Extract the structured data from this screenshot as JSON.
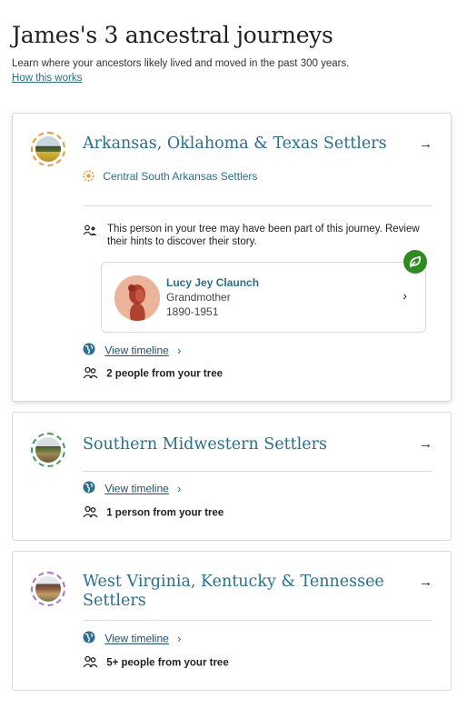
{
  "header": {
    "title": "James's 3 ancestral journeys",
    "subtitle": "Learn where your ancestors likely lived and moved in the past 300 years.",
    "how_link": "How this works"
  },
  "journeys": [
    {
      "title": "Arkansas, Oklahoma & Texas Settlers",
      "ring_color": "#e69a3a",
      "region": "Central South Arkansas Settlers",
      "hint": "This person in your tree may have been part of this journey. Review their hints to discover their story.",
      "person": {
        "name": "Lucy Jey Claunch",
        "relation": "Grandmother",
        "years": "1890-1951"
      },
      "timeline_label": "View timeline",
      "people_label": "2 people from your tree"
    },
    {
      "title": "Southern Midwestern Settlers",
      "ring_color": "#3f9a5c",
      "timeline_label": "View timeline",
      "people_label": "1 person from your tree"
    },
    {
      "title": "West Virginia, Kentucky & Tennessee Settlers",
      "ring_color": "#b06bd6",
      "timeline_label": "View timeline",
      "people_label": "5+ people from your tree"
    }
  ],
  "colors": {
    "accent": "#2a6f8f",
    "leaf": "#2e8b1f"
  }
}
